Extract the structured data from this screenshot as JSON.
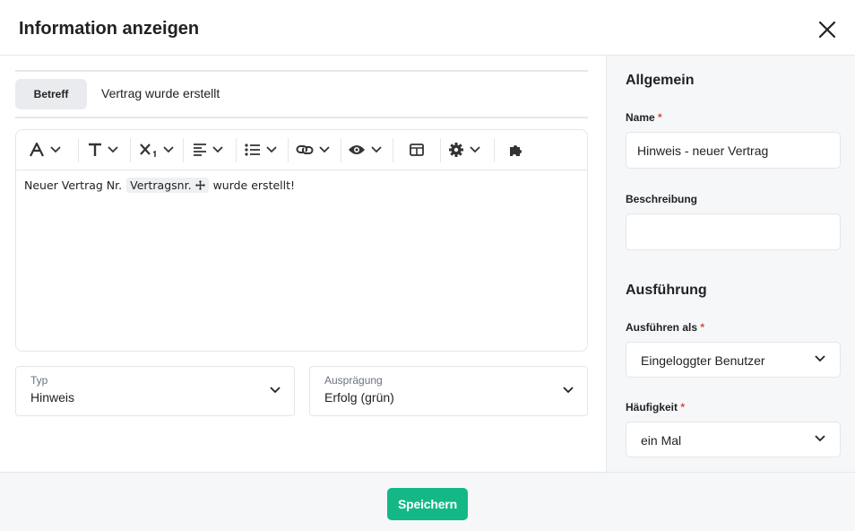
{
  "dialog": {
    "title": "Information anzeigen"
  },
  "subject": {
    "tag_label": "Betreff",
    "value": "Vertrag wurde erstellt"
  },
  "editor": {
    "toolbar": [
      "font-color-icon",
      "text-size-icon",
      "subscript-icon",
      "align-left-icon",
      "bulleted-list-icon",
      "link-icon",
      "eye-icon",
      "table-icon",
      "gear-icon",
      "puzzle-icon"
    ],
    "text_before": "Neuer Vertrag Nr.",
    "placeholder_chip": "Vertragsnr.",
    "text_after": "wurde erstellt!"
  },
  "selects": {
    "typ": {
      "label": "Typ",
      "value": "Hinweis"
    },
    "auspraegung": {
      "label": "Ausprägung",
      "value": "Erfolg (grün)"
    }
  },
  "sidebar": {
    "general_title": "Allgemein",
    "name_label": "Name",
    "name_value": "Hinweis - neuer Vertrag",
    "description_label": "Beschreibung",
    "description_value": "",
    "execution_title": "Ausführung",
    "run_as_label": "Ausführen als",
    "run_as_value": "Eingeloggter Benutzer",
    "frequency_label": "Häufigkeit",
    "frequency_value": "ein Mal",
    "required_marker": "*"
  },
  "footer": {
    "save_label": "Speichern"
  },
  "colors": {
    "accent": "#13b886",
    "required": "#e0463c",
    "panel_bg": "#f6f7f9"
  }
}
